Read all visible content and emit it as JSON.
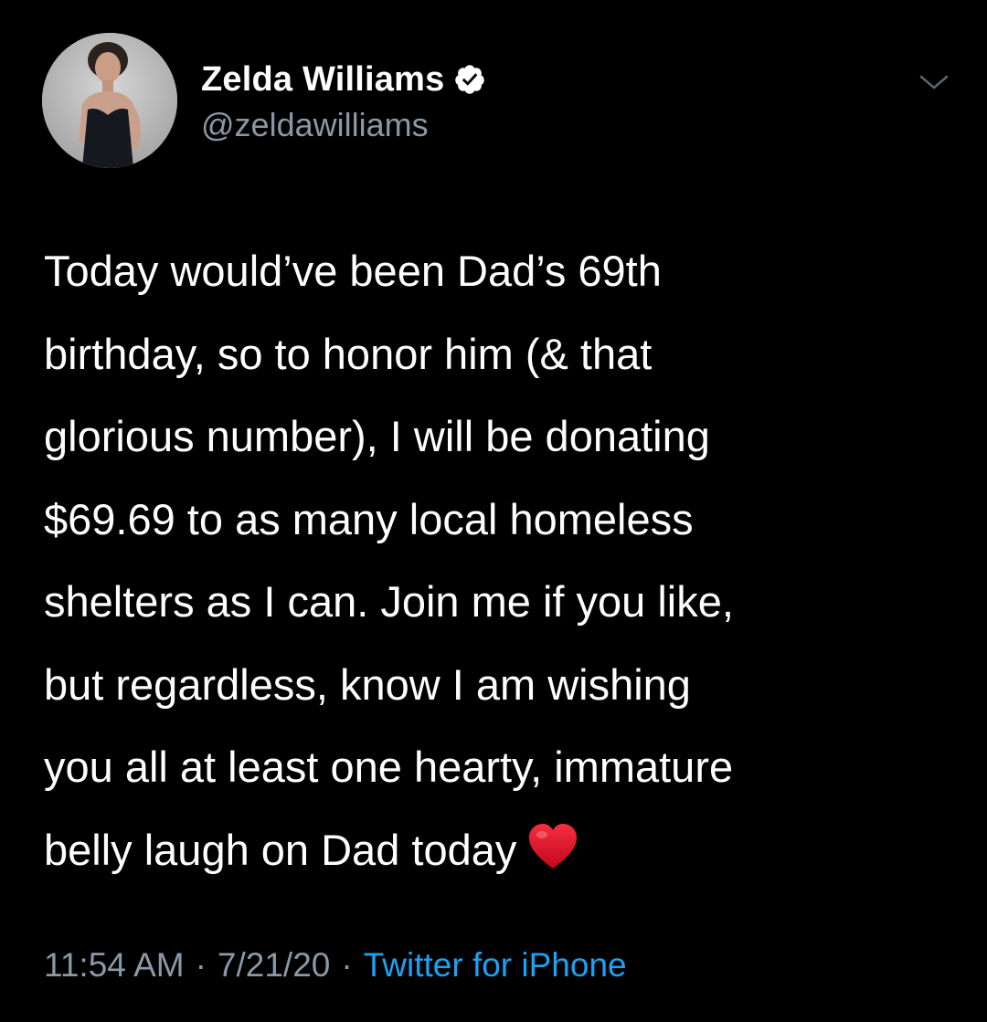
{
  "author": {
    "display_name": "Zelda Williams",
    "handle": "@zeldawilliams",
    "verified": true,
    "avatar_icon": "profile-photo"
  },
  "tweet": {
    "lines": [
      "Today would’ve been Dad’s 69th",
      "birthday, so to honor him (& that",
      "glorious number), I will be donating",
      "$69.69 to as many local homeless",
      "shelters as I can. Join me if you like,",
      "but regardless, know I am wishing",
      "you all at least one hearty, immature",
      "belly laugh on Dad today"
    ],
    "emoji": "red-heart-icon"
  },
  "meta": {
    "time": "11:54 AM",
    "separator": "·",
    "date": "7/21/20",
    "source": "Twitter for iPhone"
  },
  "colors": {
    "background": "#000000",
    "text": "#ffffff",
    "secondary": "#8b98a5",
    "link": "#1da1f2",
    "heart": "#e0102a"
  }
}
